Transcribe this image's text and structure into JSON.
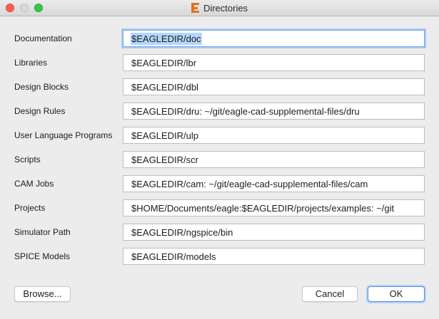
{
  "window": {
    "title": "Directories",
    "app_icon": "eagle-e-icon"
  },
  "rows": [
    {
      "label": "Documentation",
      "value": "$EAGLEDIR/doc"
    },
    {
      "label": "Libraries",
      "value": "$EAGLEDIR/lbr"
    },
    {
      "label": "Design Blocks",
      "value": "$EAGLEDIR/dbl"
    },
    {
      "label": "Design Rules",
      "value": "$EAGLEDIR/dru: ~/git/eagle-cad-supplemental-files/dru"
    },
    {
      "label": "User Language Programs",
      "value": "$EAGLEDIR/ulp"
    },
    {
      "label": "Scripts",
      "value": "$EAGLEDIR/scr"
    },
    {
      "label": "CAM Jobs",
      "value": "$EAGLEDIR/cam: ~/git/eagle-cad-supplemental-files/cam"
    },
    {
      "label": "Projects",
      "value": "$HOME/Documents/eagle:$EAGLEDIR/projects/examples: ~/git"
    },
    {
      "label": "Simulator Path",
      "value": "$EAGLEDIR/ngspice/bin"
    },
    {
      "label": "SPICE Models",
      "value": "$EAGLEDIR/models"
    }
  ],
  "buttons": {
    "browse": "Browse...",
    "cancel": "Cancel",
    "ok": "OK"
  },
  "colors": {
    "app_icon": "#e2701d",
    "focus_ring": "#a9c9f5",
    "selection": "#b3d6ff"
  }
}
